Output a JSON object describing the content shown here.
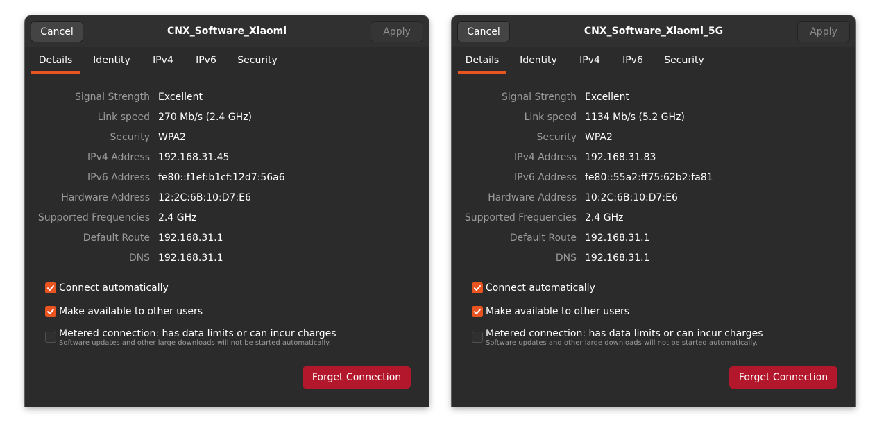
{
  "dialogs": [
    {
      "cancel_label": "Cancel",
      "title": "CNX_Software_Xiaomi",
      "apply_label": "Apply",
      "tabs": [
        "Details",
        "Identity",
        "IPv4",
        "IPv6",
        "Security"
      ],
      "active_tab": "Details",
      "details": [
        {
          "label": "Signal Strength",
          "value": "Excellent"
        },
        {
          "label": "Link speed",
          "value": "270 Mb/s (2.4 GHz)"
        },
        {
          "label": "Security",
          "value": "WPA2"
        },
        {
          "label": "IPv4 Address",
          "value": "192.168.31.45"
        },
        {
          "label": "IPv6 Address",
          "value": "fe80::f1ef:b1cf:12d7:56a6"
        },
        {
          "label": "Hardware Address",
          "value": "12:2C:6B:10:D7:E6"
        },
        {
          "label": "Supported Frequencies",
          "value": "2.4 GHz"
        },
        {
          "label": "Default Route",
          "value": "192.168.31.1"
        },
        {
          "label": "DNS",
          "value": "192.168.31.1"
        }
      ],
      "options": {
        "connect_automatically": {
          "label": "Connect automatically",
          "checked": true
        },
        "available_to_others": {
          "label": "Make available to other users",
          "checked": true
        },
        "metered": {
          "label": "Metered connection: has data limits or can incur charges",
          "checked": false,
          "note": "Software updates and other large downloads will not be started automatically."
        }
      },
      "forget_label": "Forget Connection"
    },
    {
      "cancel_label": "Cancel",
      "title": "CNX_Software_Xiaomi_5G",
      "apply_label": "Apply",
      "tabs": [
        "Details",
        "Identity",
        "IPv4",
        "IPv6",
        "Security"
      ],
      "active_tab": "Details",
      "details": [
        {
          "label": "Signal Strength",
          "value": "Excellent"
        },
        {
          "label": "Link speed",
          "value": "1134 Mb/s (5.2 GHz)"
        },
        {
          "label": "Security",
          "value": "WPA2"
        },
        {
          "label": "IPv4 Address",
          "value": "192.168.31.83"
        },
        {
          "label": "IPv6 Address",
          "value": "fe80::55a2:ff75:62b2:fa81"
        },
        {
          "label": "Hardware Address",
          "value": "10:2C:6B:10:D7:E6"
        },
        {
          "label": "Supported Frequencies",
          "value": "2.4 GHz"
        },
        {
          "label": "Default Route",
          "value": "192.168.31.1"
        },
        {
          "label": "DNS",
          "value": "192.168.31.1"
        }
      ],
      "options": {
        "connect_automatically": {
          "label": "Connect automatically",
          "checked": true
        },
        "available_to_others": {
          "label": "Make available to other users",
          "checked": true
        },
        "metered": {
          "label": "Metered connection: has data limits or can incur charges",
          "checked": false,
          "note": "Software updates and other large downloads will not be started automatically."
        }
      },
      "forget_label": "Forget Connection"
    }
  ],
  "colors": {
    "accent": "#e95420",
    "destructive": "#b2172b",
    "background": "#2b2b2b"
  }
}
